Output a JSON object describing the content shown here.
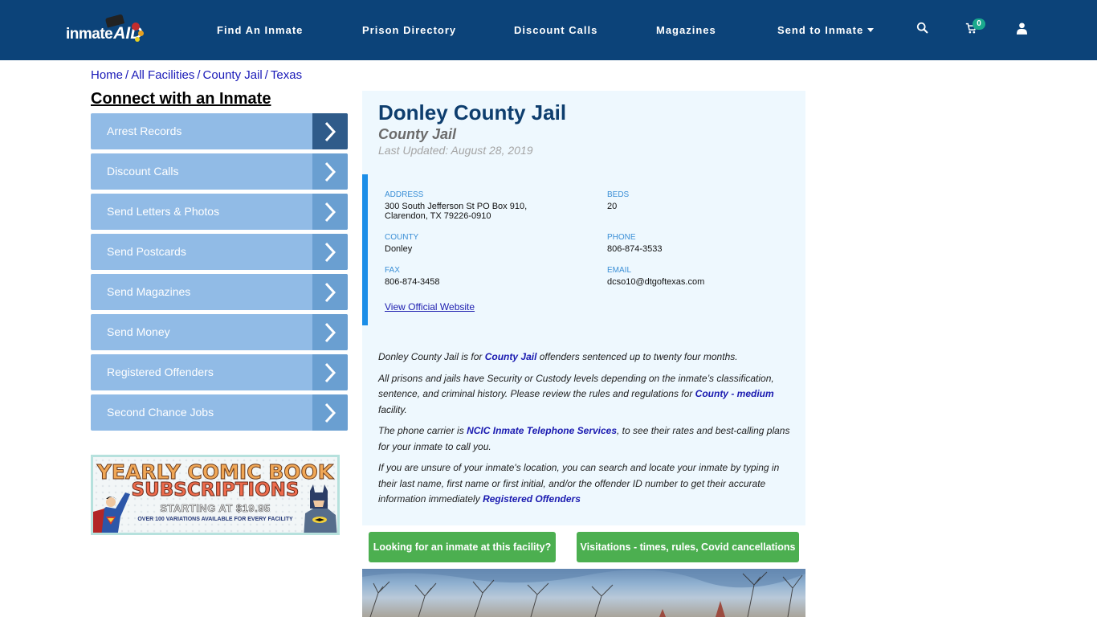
{
  "header": {
    "logo_text": "inmate",
    "logo_accent": "AID",
    "nav": [
      {
        "label": "Find An Inmate"
      },
      {
        "label": "Prison Directory"
      },
      {
        "label": "Discount Calls"
      },
      {
        "label": "Magazines"
      },
      {
        "label": "Send to Inmate",
        "has_dropdown": true
      }
    ],
    "icons": [
      "search-icon",
      "cart-icon",
      "user-icon"
    ],
    "cart_count": "0",
    "colors": {
      "nav_bg": "#0c4379",
      "badge": "#1aa98d"
    }
  },
  "breadcrumb": {
    "items": [
      "Home",
      "All Facilities",
      "County Jail",
      "Texas"
    ],
    "separator": "/"
  },
  "sidebar": {
    "title": "Connect with an Inmate",
    "items": [
      {
        "label": "Arrest Records",
        "active": true
      },
      {
        "label": "Discount Calls"
      },
      {
        "label": "Send Letters & Photos"
      },
      {
        "label": "Send Postcards"
      },
      {
        "label": "Send Magazines"
      },
      {
        "label": "Send Money"
      },
      {
        "label": "Registered Offenders"
      },
      {
        "label": "Second Chance Jobs"
      }
    ],
    "banner": {
      "line1": "YEARLY COMIC BOOK",
      "line2": "SUBSCRIPTIONS",
      "line3": "STARTING AT $19.95",
      "line4": "OVER 100 VARIATIONS AVAILABLE FOR EVERY FACILITY"
    }
  },
  "facility": {
    "name": "Donley County Jail",
    "type": "County Jail",
    "last_updated": "Last Updated: August 28, 2019",
    "fields": {
      "address": {
        "label": "ADDRESS",
        "line1": "300 South Jefferson St PO Box 910,",
        "line2": "Clarendon, TX 79226-0910"
      },
      "beds": {
        "label": "BEDS",
        "value": "20"
      },
      "county": {
        "label": "COUNTY",
        "value": "Donley"
      },
      "phone": {
        "label": "PHONE",
        "value": "806-874-3533"
      },
      "fax": {
        "label": "FAX",
        "value": "806-874-3458"
      },
      "email": {
        "label": "EMAIL",
        "value": "dcso10@dtgoftexas.com"
      }
    },
    "official_link": "View Official Website",
    "description": {
      "p1": {
        "pre": "Donley County Jail is for ",
        "link": "County Jail",
        "post": " offenders sentenced up to twenty four months."
      },
      "p2": {
        "pre": "All prisons and jails have Security or Custody levels depending on the inmate’s classification, sentence, and criminal history. Please review the rules and regulations for ",
        "link": "County - medium",
        "post": " facility."
      },
      "p3": {
        "pre": "The phone carrier is ",
        "link": "NCIC Inmate Telephone Services",
        "post": ", to see their rates and best-calling plans for your inmate to call you."
      },
      "p4": {
        "pre": "If you are unsure of your inmate's location, you can search and locate your inmate by typing in their last name, first name or first initial, and/or the offender ID number to get their accurate information immediately ",
        "link": "Registered Offenders",
        "post": ""
      }
    }
  },
  "actions": {
    "find_inmate": "Looking for an inmate at this facility?",
    "visitations": "Visitations - times, rules, Covid cancellations",
    "button_color": "#4caf50"
  }
}
